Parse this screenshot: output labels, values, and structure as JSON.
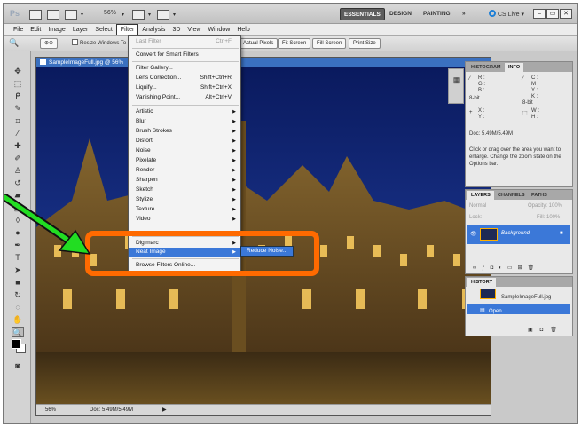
{
  "app": {
    "logo": "Ps",
    "zoom": "56%",
    "workspaces": [
      "ESSENTIALS",
      "DESIGN",
      "PAINTING"
    ],
    "overflow": "»",
    "cslive": "CS Live"
  },
  "menubar": [
    "File",
    "Edit",
    "Image",
    "Layer",
    "Select",
    "Filter",
    "Analysis",
    "3D",
    "View",
    "Window",
    "Help"
  ],
  "options": {
    "resize_label": "Resize Windows To",
    "buttons": [
      "Actual Pixels",
      "Fit Screen",
      "Fill Screen",
      "Print Size"
    ]
  },
  "document": {
    "tab_title": "SampleImageFull.jpg @ 56%",
    "status_zoom": "56%",
    "status_doc": "Doc: 5.49M/5.49M"
  },
  "filter_menu": {
    "items": [
      {
        "label": "Last Filter",
        "shortcut": "Ctrl+F",
        "disabled": true
      },
      {
        "label": "Convert for Smart Filters"
      },
      {
        "label": "Filter Gallery..."
      },
      {
        "label": "Lens Correction...",
        "shortcut": "Shift+Ctrl+R"
      },
      {
        "label": "Liquify...",
        "shortcut": "Shift+Ctrl+X"
      },
      {
        "label": "Vanishing Point...",
        "shortcut": "Alt+Ctrl+V"
      },
      {
        "label": "Artistic",
        "submenu": true
      },
      {
        "label": "Blur",
        "submenu": true
      },
      {
        "label": "Brush Strokes",
        "submenu": true
      },
      {
        "label": "Distort",
        "submenu": true
      },
      {
        "label": "Noise",
        "submenu": true
      },
      {
        "label": "Pixelate",
        "submenu": true
      },
      {
        "label": "Render",
        "submenu": true
      },
      {
        "label": "Sharpen",
        "submenu": true
      },
      {
        "label": "Sketch",
        "submenu": true
      },
      {
        "label": "Stylize",
        "submenu": true
      },
      {
        "label": "Texture",
        "submenu": true
      },
      {
        "label": "Video",
        "submenu": true
      },
      {
        "label": "Digimarc",
        "submenu": true
      },
      {
        "label": "Neat Image",
        "submenu": true,
        "selected": true
      },
      {
        "label": "Browse Filters Online..."
      }
    ],
    "submenu_item": "Reduce Noise..."
  },
  "panels": {
    "info_tabs": [
      "HISTOGRAM",
      "INFO"
    ],
    "info_values": {
      "r": "R :",
      "g": "G :",
      "b": "B :",
      "c": "C :",
      "m": "M :",
      "y": "Y :",
      "k": "K :",
      "bit1": "8-bit",
      "bit2": "8-bit",
      "x": "X :",
      "ycoord": "Y :",
      "w": "W :",
      "h": "H :"
    },
    "info_doc": "Doc: 5.49M/5.49M",
    "info_hint": "Click or drag over the area you want to enlarge. Change the zoom state on the Options bar.",
    "layers_tabs": [
      "LAYERS",
      "CHANNELS",
      "PATHS"
    ],
    "blend_mode": "Normal",
    "opacity": "Opacity: 100%",
    "lock_label": "Lock:",
    "fill": "Fill: 100%",
    "layer_name": "Background",
    "history_tab": "HISTORY",
    "history_items": [
      "SampleImageFull.jpg",
      "Open"
    ]
  },
  "colors": {
    "accent": "#3b78d8",
    "highlight": "#ff6a00",
    "arrow": "#22dd22"
  }
}
